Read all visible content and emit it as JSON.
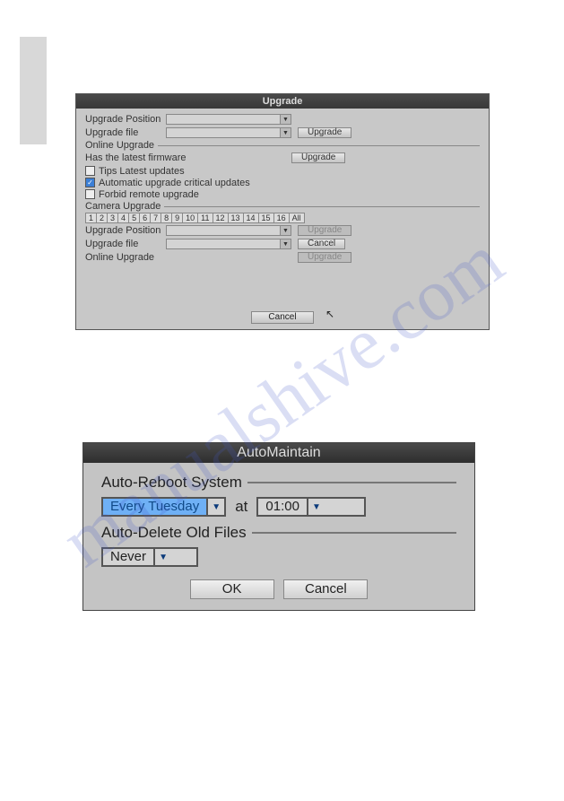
{
  "watermark": "manualshive.com",
  "upgrade": {
    "title": "Upgrade",
    "position_label": "Upgrade Position",
    "file_label": "Upgrade file",
    "upgrade_button": "Upgrade",
    "online_section": "Online Upgrade",
    "firmware_status": "Has the latest firmware",
    "tips_label": "Tips Latest updates",
    "auto_label": "Automatic upgrade critical updates",
    "forbid_label": "Forbid remote upgrade",
    "camera_section": "Camera Upgrade",
    "channels": [
      "1",
      "2",
      "3",
      "4",
      "5",
      "6",
      "7",
      "8",
      "9",
      "10",
      "11",
      "12",
      "13",
      "14",
      "15",
      "16",
      "All"
    ],
    "cancel_button": "Cancel",
    "cam_position_label": "Upgrade Position",
    "cam_file_label": "Upgrade file",
    "cam_online_label": "Online Upgrade",
    "cam_upgrade_button": "Upgrade",
    "cam_cancel_button": "Cancel",
    "footer_cancel": "Cancel"
  },
  "automaintain": {
    "title": "AutoMaintain",
    "reboot_section": "Auto-Reboot System",
    "reboot_day": "Every Tuesday",
    "at": "at",
    "reboot_time": "01:00",
    "delete_section": "Auto-Delete Old Files",
    "delete_value": "Never",
    "ok": "OK",
    "cancel": "Cancel"
  }
}
